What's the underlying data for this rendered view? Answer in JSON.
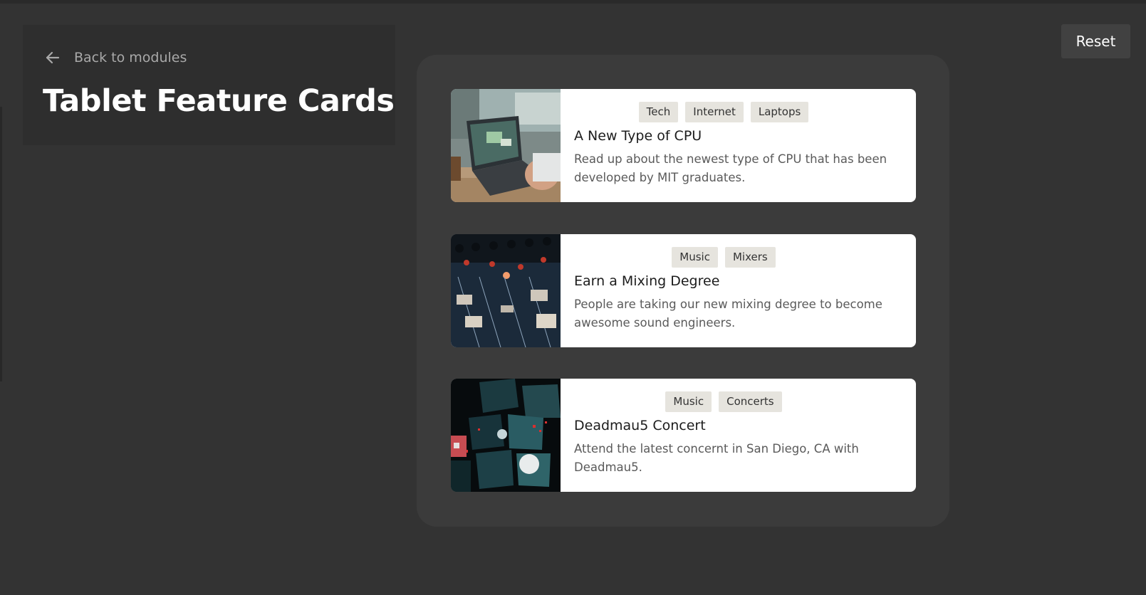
{
  "header": {
    "back_label": "Back to modules",
    "title": "Tablet Feature Cards"
  },
  "toolbar": {
    "reset_label": "Reset"
  },
  "cards": [
    {
      "tags": [
        "Tech",
        "Internet",
        "Laptops"
      ],
      "title": "A New Type of CPU",
      "description": "Read up about the newest type of CPU that has been developed by MIT graduates.",
      "image_icon": "laptop-photo"
    },
    {
      "tags": [
        "Music",
        "Mixers"
      ],
      "title": "Earn a Mixing Degree",
      "description": "People are taking our new mixing degree to become awesome sound engineers.",
      "image_icon": "mixer-photo"
    },
    {
      "tags": [
        "Music",
        "Concerts"
      ],
      "title": "Deadmau5 Concert",
      "description": "Attend the latest concernt in San Diego, CA with Deadmau5.",
      "image_icon": "concert-photo"
    }
  ],
  "colors": {
    "background": "#333333",
    "panel": "#3b3b3b",
    "card": "#ffffff",
    "tag": "#e6e4de",
    "button": "#414141"
  }
}
